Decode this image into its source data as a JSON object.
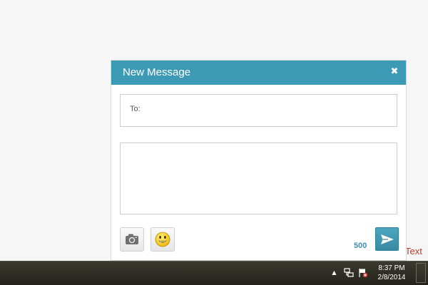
{
  "dialog": {
    "title": "New Message",
    "close_glyph": "✖",
    "to_label": "To:",
    "to_value": "",
    "message_value": "",
    "char_count": "500",
    "icons": {
      "camera": "camera-icon",
      "emoji": "smiley-icon",
      "send": "send-icon"
    }
  },
  "background_text": "Text",
  "taskbar": {
    "tray_arrow_glyph": "▲",
    "time": "8:37 PM",
    "date": "2/8/2014"
  },
  "colors": {
    "header": "#3d9ab5",
    "accent": "#3d8fb0",
    "background_text": "#c0392b"
  }
}
